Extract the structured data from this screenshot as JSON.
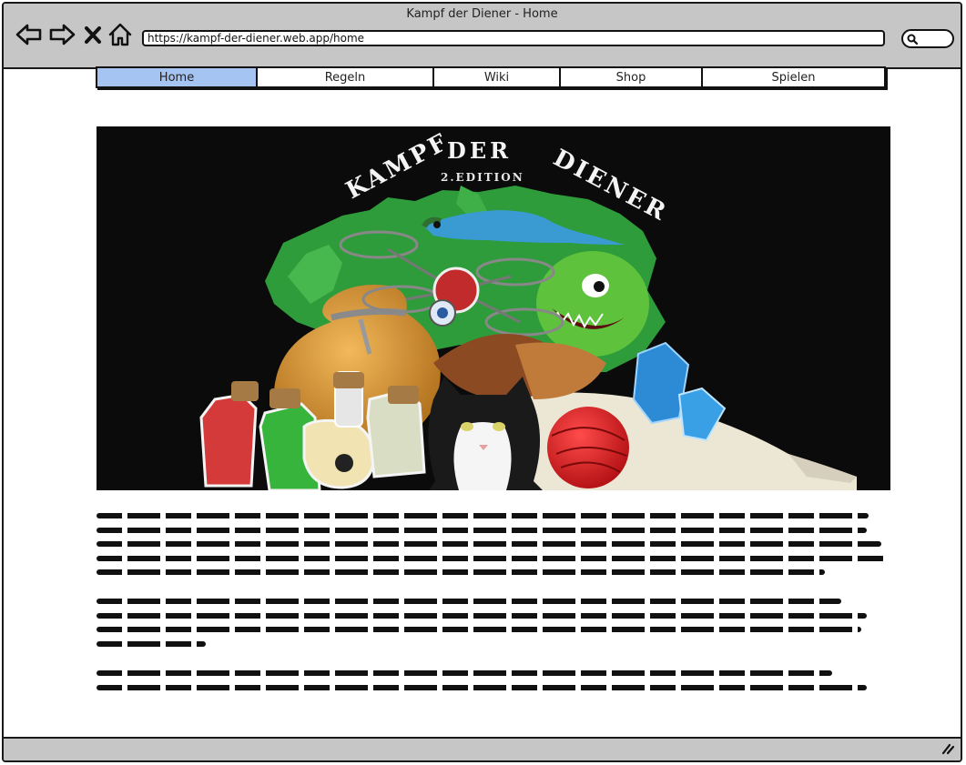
{
  "window": {
    "title": "Kampf der Diener - Home"
  },
  "toolbar": {
    "url": "https://kampf-der-diener.web.app/home"
  },
  "tabs": [
    {
      "label": "Home",
      "active": true
    },
    {
      "label": "Regeln",
      "active": false
    },
    {
      "label": "Wiki",
      "active": false
    },
    {
      "label": "Shop",
      "active": false
    },
    {
      "label": "Spielen",
      "active": false
    }
  ],
  "hero": {
    "title_left": "KAMPF",
    "title_mid": "DER",
    "title_right": "DIENER",
    "edition": "2.EDITION"
  },
  "colors": {
    "chrome": "#c6c6c6",
    "active_tab": "#a6c4f2",
    "hero_bg": "#0b0b0b"
  }
}
